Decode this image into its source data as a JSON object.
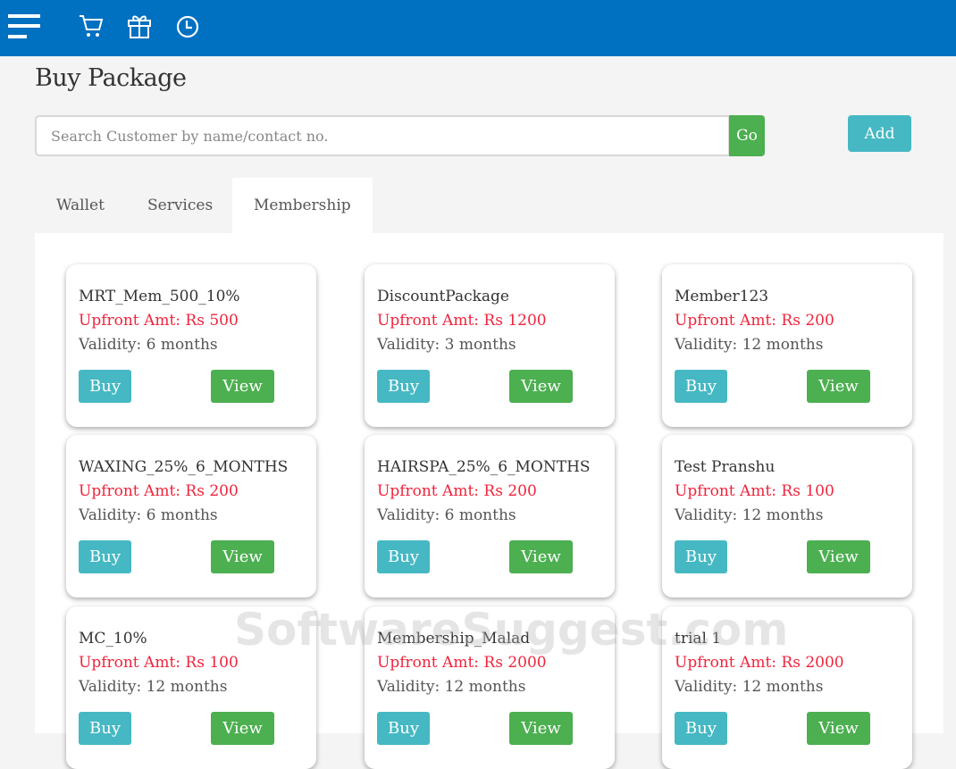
{
  "header": {
    "icons": [
      "menu-icon",
      "cart-icon",
      "gift-icon",
      "clock-icon"
    ]
  },
  "page_title": "Buy Package",
  "search": {
    "placeholder": "Search Customer by name/contact no.",
    "value": "",
    "go_label": "Go"
  },
  "add_label": "Add",
  "tabs": [
    {
      "label": "Wallet"
    },
    {
      "label": "Services"
    },
    {
      "label": "Membership",
      "active": true
    }
  ],
  "cards": [
    {
      "name": "MRT_Mem_500_10%",
      "upfront": "Upfront Amt: Rs 500",
      "validity": "Validity: 6 months"
    },
    {
      "name": "DiscountPackage",
      "upfront": "Upfront Amt: Rs 1200",
      "validity": "Validity: 3 months"
    },
    {
      "name": "Member123",
      "upfront": "Upfront Amt: Rs 200",
      "validity": "Validity: 12 months"
    },
    {
      "name": "WAXING_25%_6_MONTHS",
      "upfront": "Upfront Amt: Rs 200",
      "validity": "Validity: 6 months"
    },
    {
      "name": "HAIRSPA_25%_6_MONTHS",
      "upfront": "Upfront Amt: Rs 200",
      "validity": "Validity: 6 months"
    },
    {
      "name": "Test Pranshu",
      "upfront": "Upfront Amt: Rs 100",
      "validity": "Validity: 12 months"
    },
    {
      "name": "MC_10%",
      "upfront": "Upfront Amt: Rs 100",
      "validity": "Validity: 12 months"
    },
    {
      "name": "Membership_Malad",
      "upfront": "Upfront Amt: Rs 2000",
      "validity": "Validity: 12 months"
    },
    {
      "name": "trial 1",
      "upfront": "Upfront Amt: Rs 2000",
      "validity": "Validity: 12 months"
    }
  ],
  "buy_label": "Buy",
  "view_label": "View",
  "watermark": "SoftwareSuggest.com"
}
